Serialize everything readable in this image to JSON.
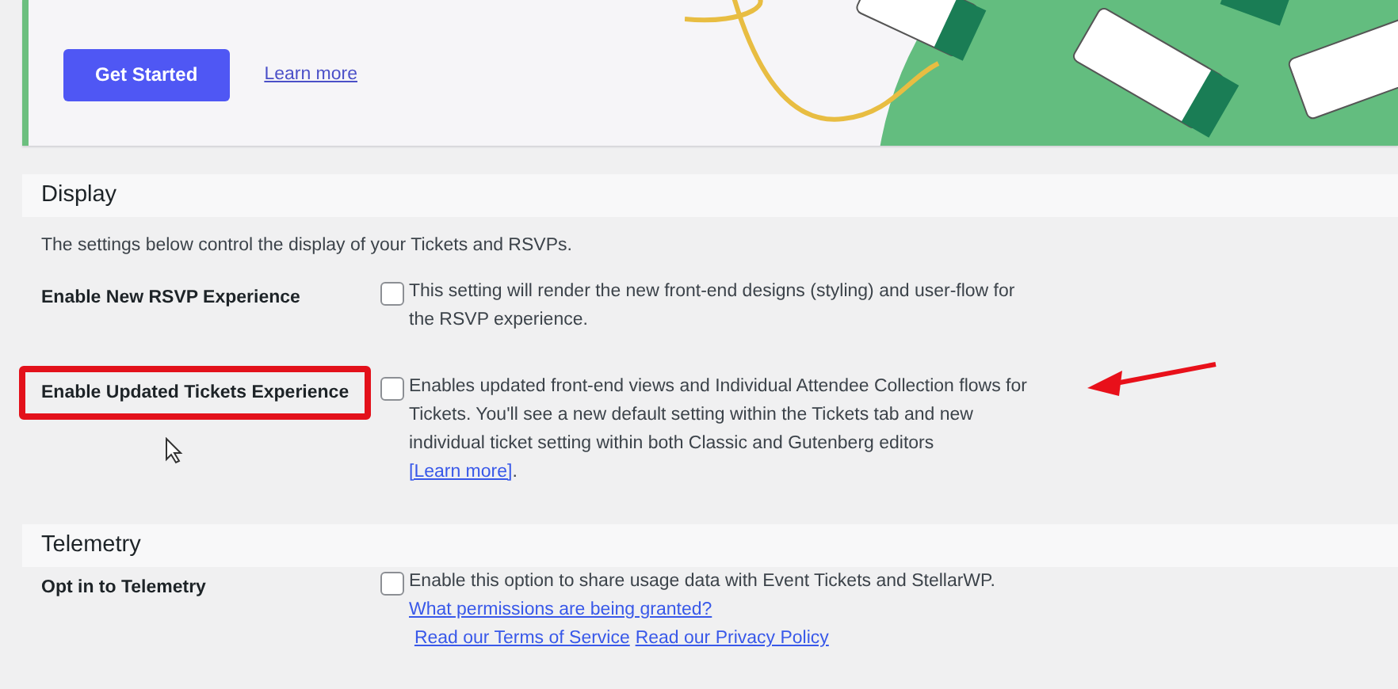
{
  "banner": {
    "buttons": [
      {
        "kind": "primary",
        "label": "Get Started"
      },
      {
        "kind": "link",
        "label": "Learn more"
      }
    ]
  },
  "sections": [
    {
      "title": "Display",
      "description": "The settings below control the display of your Tickets and RSVPs.",
      "settings": [
        {
          "label": "Enable New RSVP Experience",
          "checked": false,
          "highlighted": false,
          "help": [
            {
              "kind": "text",
              "text": "This setting will render the new front-end designs (styling) and user-flow for the RSVP experience."
            }
          ]
        },
        {
          "label": "Enable Updated Tickets Experience",
          "checked": false,
          "highlighted": true,
          "help": [
            {
              "kind": "text",
              "text": "Enables updated front-end views and Individual Attendee Collection flows for Tickets. You'll see a new default setting within the Tickets tab and new individual ticket setting within both Classic and Gutenberg editors "
            },
            {
              "kind": "link",
              "text": "[Learn more]"
            },
            {
              "kind": "text",
              "text": "."
            }
          ]
        }
      ]
    },
    {
      "title": "Telemetry",
      "settings": [
        {
          "label": "Opt in to Telemetry",
          "checked": false,
          "highlighted": false,
          "help": [
            {
              "kind": "text",
              "text": "Enable this option to share usage data with Event Tickets and StellarWP. "
            },
            {
              "kind": "link",
              "text": "What permissions are being granted?"
            },
            {
              "kind": "link",
              "text": "Read our Terms of Service"
            },
            {
              "kind": "link",
              "text": "Read our Privacy Policy"
            }
          ]
        }
      ]
    }
  ]
}
